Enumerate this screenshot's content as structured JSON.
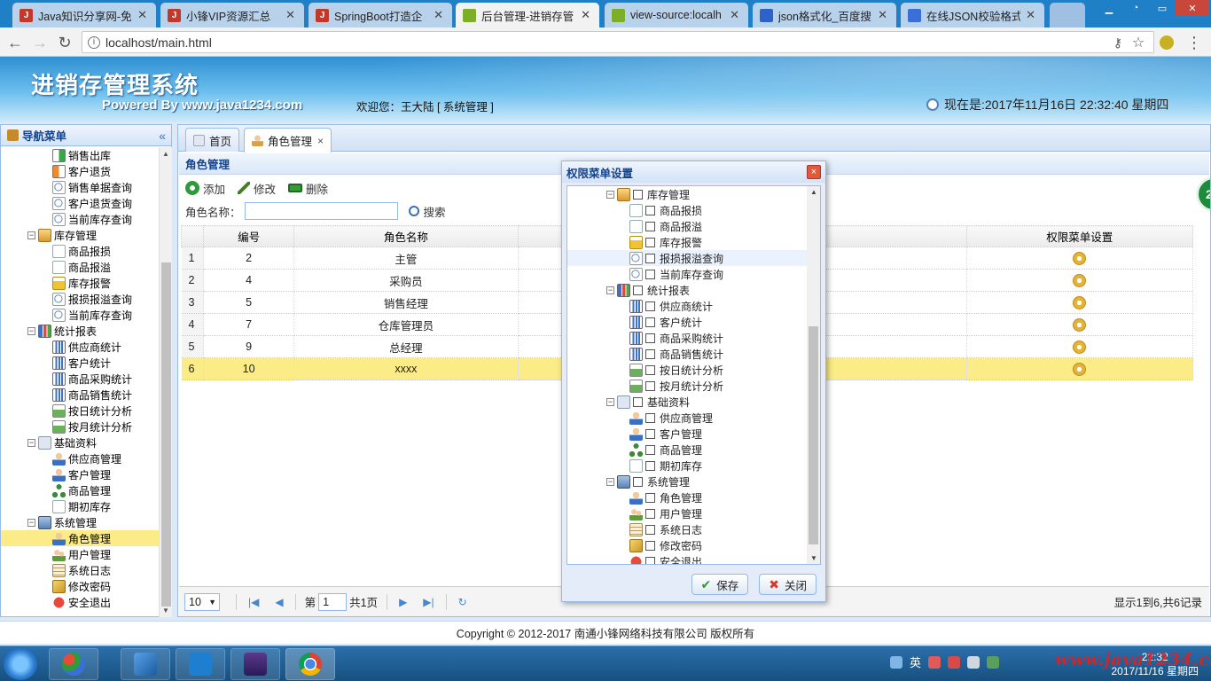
{
  "browser": {
    "tabs": [
      {
        "title": "Java知识分享网-免",
        "fav": "J",
        "color": "#c0392b"
      },
      {
        "title": "小锋VIP资源汇总",
        "fav": "J",
        "color": "#c0392b"
      },
      {
        "title": "SpringBoot打造企",
        "fav": "J",
        "color": "#c0392b"
      },
      {
        "title": "后台管理-进销存管",
        "fav": "",
        "color": "#7cae2a"
      },
      {
        "title": "view-source:localh",
        "fav": "",
        "color": "#7cae2a"
      },
      {
        "title": "json格式化_百度搜",
        "fav": "",
        "color": "#2d63c8"
      },
      {
        "title": "在线JSON校验格式",
        "fav": "",
        "color": "#3a6fd8"
      }
    ],
    "url": "localhost/main.html"
  },
  "header": {
    "title": "进销存管理系统",
    "powered": "Powered By www.java1234.com",
    "welcome": "欢迎您：王大陆 [ 系统管理 ]",
    "datetime": "现在是:2017年11月16日 22:32:40 星期四"
  },
  "nav": {
    "title": "导航菜单",
    "collapse": "«",
    "items": [
      {
        "label": "销售出库",
        "level": 2,
        "icon": "ic-out"
      },
      {
        "label": "客户退货",
        "level": 2,
        "icon": "ic-ret"
      },
      {
        "label": "销售单据查询",
        "level": 2,
        "icon": "ic-q"
      },
      {
        "label": "客户退货查询",
        "level": 2,
        "icon": "ic-q"
      },
      {
        "label": "当前库存查询",
        "level": 2,
        "icon": "ic-q"
      },
      {
        "label": "库存管理",
        "level": 1,
        "icon": "ic-folder"
      },
      {
        "label": "商品报损",
        "level": 2,
        "icon": "ic-doc"
      },
      {
        "label": "商品报溢",
        "level": 2,
        "icon": "ic-doc"
      },
      {
        "label": "库存报警",
        "level": 2,
        "icon": "ic-warn"
      },
      {
        "label": "报损报溢查询",
        "level": 2,
        "icon": "ic-q"
      },
      {
        "label": "当前库存查询",
        "level": 2,
        "icon": "ic-q"
      },
      {
        "label": "统计报表",
        "level": 1,
        "icon": "ic-chart"
      },
      {
        "label": "供应商统计",
        "level": 2,
        "icon": "ic-bar"
      },
      {
        "label": "客户统计",
        "level": 2,
        "icon": "ic-bar"
      },
      {
        "label": "商品采购统计",
        "level": 2,
        "icon": "ic-bar"
      },
      {
        "label": "商品销售统计",
        "level": 2,
        "icon": "ic-bar"
      },
      {
        "label": "按日统计分析",
        "level": 2,
        "icon": "ic-cal"
      },
      {
        "label": "按月统计分析",
        "level": 2,
        "icon": "ic-cal"
      },
      {
        "label": "基础资料",
        "level": 1,
        "icon": "ic-base"
      },
      {
        "label": "供应商管理",
        "level": 2,
        "icon": "ic-user"
      },
      {
        "label": "客户管理",
        "level": 2,
        "icon": "ic-user"
      },
      {
        "label": "商品管理",
        "level": 2,
        "icon": "ic-tree"
      },
      {
        "label": "期初库存",
        "level": 2,
        "icon": "ic-doc"
      },
      {
        "label": "系统管理",
        "level": 1,
        "icon": "ic-sys"
      },
      {
        "label": "角色管理",
        "level": 2,
        "icon": "ic-user",
        "selected": true
      },
      {
        "label": "用户管理",
        "level": 2,
        "icon": "ic-users"
      },
      {
        "label": "系统日志",
        "level": 2,
        "icon": "ic-log"
      },
      {
        "label": "修改密码",
        "level": 2,
        "icon": "ic-key"
      },
      {
        "label": "安全退出",
        "level": 2,
        "icon": "ic-exit"
      }
    ]
  },
  "tabs": {
    "home": "首页",
    "role": "角色管理",
    "close": "×"
  },
  "grid": {
    "title": "角色管理",
    "add": "添加",
    "edit": "修改",
    "del": "删除",
    "search_label": "角色名称：",
    "search_value": "",
    "search_btn": "搜索",
    "col_id": "编号",
    "col_name": "角色名称",
    "col_perm": "权限菜单设置",
    "rows": [
      {
        "n": "1",
        "id": "2",
        "name": "主管"
      },
      {
        "n": "2",
        "id": "4",
        "name": "采购员"
      },
      {
        "n": "3",
        "id": "5",
        "name": "销售经理"
      },
      {
        "n": "4",
        "id": "7",
        "name": "仓库管理员"
      },
      {
        "n": "5",
        "id": "9",
        "name": "总经理"
      },
      {
        "n": "6",
        "id": "10",
        "name": "xxxx",
        "highlight": true
      }
    ]
  },
  "pager": {
    "size": "10",
    "page_prefix": "第",
    "page": "1",
    "page_suffix": "共1页",
    "summary": "显示1到6,共6记录"
  },
  "badge": "20",
  "dialog": {
    "title": "权限菜单设置",
    "close": "×",
    "items": [
      {
        "label": "库存管理",
        "level": 1,
        "icon": "ic-folder"
      },
      {
        "label": "商品报损",
        "level": 2,
        "icon": "ic-doc"
      },
      {
        "label": "商品报溢",
        "level": 2,
        "icon": "ic-doc"
      },
      {
        "label": "库存报警",
        "level": 2,
        "icon": "ic-warn"
      },
      {
        "label": "报损报溢查询",
        "level": 2,
        "icon": "ic-q",
        "hover": true
      },
      {
        "label": "当前库存查询",
        "level": 2,
        "icon": "ic-q"
      },
      {
        "label": "统计报表",
        "level": 1,
        "icon": "ic-chart"
      },
      {
        "label": "供应商统计",
        "level": 2,
        "icon": "ic-bar"
      },
      {
        "label": "客户统计",
        "level": 2,
        "icon": "ic-bar"
      },
      {
        "label": "商品采购统计",
        "level": 2,
        "icon": "ic-bar"
      },
      {
        "label": "商品销售统计",
        "level": 2,
        "icon": "ic-bar"
      },
      {
        "label": "按日统计分析",
        "level": 2,
        "icon": "ic-cal"
      },
      {
        "label": "按月统计分析",
        "level": 2,
        "icon": "ic-cal"
      },
      {
        "label": "基础资料",
        "level": 1,
        "icon": "ic-base"
      },
      {
        "label": "供应商管理",
        "level": 2,
        "icon": "ic-user"
      },
      {
        "label": "客户管理",
        "level": 2,
        "icon": "ic-user"
      },
      {
        "label": "商品管理",
        "level": 2,
        "icon": "ic-tree"
      },
      {
        "label": "期初库存",
        "level": 2,
        "icon": "ic-doc"
      },
      {
        "label": "系统管理",
        "level": 1,
        "icon": "ic-sys"
      },
      {
        "label": "角色管理",
        "level": 2,
        "icon": "ic-user"
      },
      {
        "label": "用户管理",
        "level": 2,
        "icon": "ic-users"
      },
      {
        "label": "系统日志",
        "level": 2,
        "icon": "ic-log"
      },
      {
        "label": "修改密码",
        "level": 2,
        "icon": "ic-key"
      },
      {
        "label": "安全退出",
        "level": 2,
        "icon": "ic-exit"
      }
    ],
    "save": "保存",
    "cancel": "关闭"
  },
  "footer": "Copyright © 2012-2017 南通小锋网络科技有限公司 版权所有",
  "taskbar": {
    "ime": "英",
    "time": "22:32",
    "date": "2017/11/16 星期四",
    "watermark": "www.java1234.com"
  }
}
